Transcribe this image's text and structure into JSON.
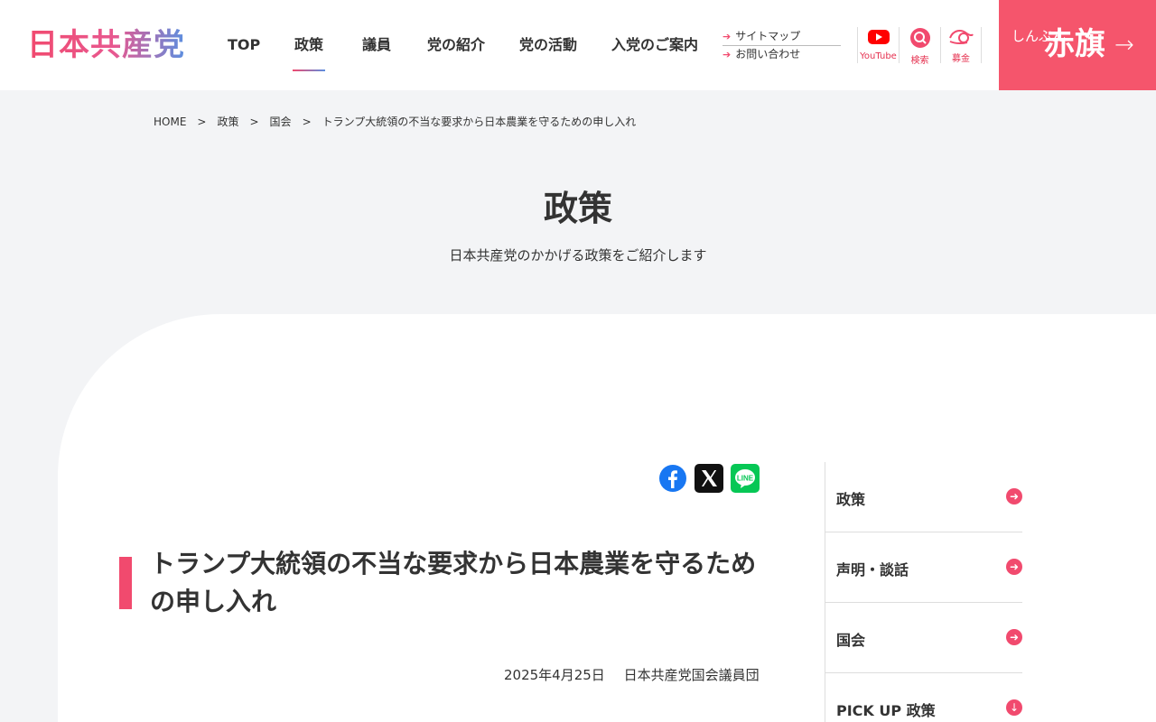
{
  "header": {
    "logo_text": "日本共産党",
    "nav": [
      {
        "label": "TOP"
      },
      {
        "label": "政策"
      },
      {
        "label": "議員"
      },
      {
        "label": "党の紹介"
      },
      {
        "label": "党の活動"
      },
      {
        "label": "入党のご案内"
      }
    ],
    "active_nav": "政策",
    "sublinks": [
      {
        "label": "サイトマップ"
      },
      {
        "label": "お問い合わせ"
      }
    ],
    "icons": [
      {
        "label": "YouTube",
        "icon": "youtube-icon"
      },
      {
        "label": "検索",
        "icon": "search-icon"
      },
      {
        "label": "募金",
        "icon": "donation-icon"
      }
    ],
    "akahata": {
      "small": "しんぶん",
      "big": "赤旗",
      "arrow": "→"
    }
  },
  "breadcrumb": [
    {
      "label": "HOME"
    },
    {
      "label": "政策"
    },
    {
      "label": "国会"
    },
    {
      "label": "トランプ大統領の不当な要求から日本農業を守るための申し入れ"
    }
  ],
  "hero": {
    "title": "政策",
    "subtitle": "日本共産党のかかげる政策をご紹介します"
  },
  "share": [
    {
      "name": "facebook",
      "icon": "facebook-icon"
    },
    {
      "name": "x",
      "icon": "x-icon"
    },
    {
      "name": "line",
      "icon": "line-icon"
    }
  ],
  "article": {
    "title": "トランプ大統領の不当な要求から日本農業を守るための申し入れ",
    "date": "2025年4月25日",
    "author": "日本共産党国会議員団"
  },
  "sidebar": [
    {
      "label": "政策",
      "icon": "arrow-right-circle-icon"
    },
    {
      "label": "声明・談話",
      "icon": "arrow-right-circle-icon"
    },
    {
      "label": "国会",
      "icon": "arrow-right-circle-icon"
    },
    {
      "label": "PICK UP 政策",
      "icon": "arrow-down-circle-icon"
    }
  ],
  "colors": {
    "accent": "#f14a6e",
    "akahata_bg": "#f5556c",
    "page_bg": "#f3f4f6",
    "youtube": "#ff0000",
    "line": "#06c755",
    "facebook": "#1877f2"
  }
}
